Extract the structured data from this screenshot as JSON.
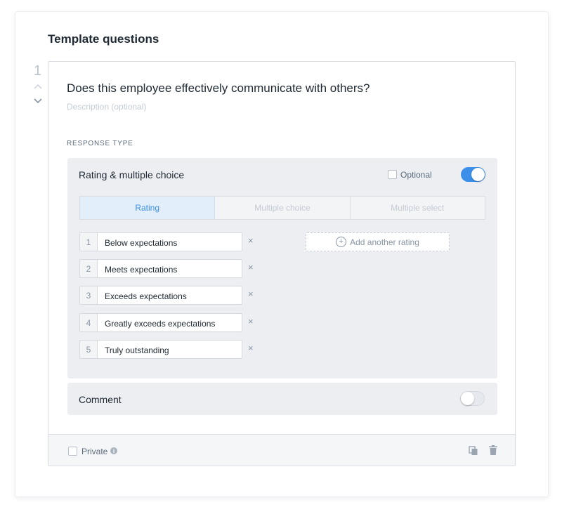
{
  "section": {
    "title": "Template questions"
  },
  "question": {
    "number": "1",
    "title": "Does this employee effectively communicate with others?",
    "description_placeholder": "Description (optional)",
    "response_type_label": "RESPONSE TYPE"
  },
  "response": {
    "title": "Rating & multiple choice",
    "optional_label": "Optional",
    "optional_checked": false,
    "enabled": true,
    "tabs": [
      {
        "label": "Rating",
        "active": true
      },
      {
        "label": "Multiple choice",
        "active": false
      },
      {
        "label": "Multiple select",
        "active": false
      }
    ],
    "ratings": [
      {
        "num": "1",
        "label": "Below expectations",
        "remove": "×"
      },
      {
        "num": "2",
        "label": "Meets expectations",
        "remove": "×"
      },
      {
        "num": "3",
        "label": "Exceeds expectations",
        "remove": "×"
      },
      {
        "num": "4",
        "label": "Greatly exceeds expectations",
        "remove": "×"
      },
      {
        "num": "5",
        "label": "Truly outstanding",
        "remove": "×"
      }
    ],
    "add_rating_label": "Add another rating"
  },
  "comment": {
    "title": "Comment",
    "enabled": false
  },
  "footer": {
    "private_label": "Private",
    "private_checked": false,
    "info_glyph": "i"
  },
  "icons": {
    "up": "chevron-up-icon",
    "down": "chevron-down-icon",
    "copy": "copy-icon",
    "trash": "trash-icon",
    "plus": "plus-circle-icon",
    "info": "info-icon"
  },
  "colors": {
    "accent": "#3b8fe8",
    "panel": "#eceef2",
    "muted": "#8795a3"
  }
}
